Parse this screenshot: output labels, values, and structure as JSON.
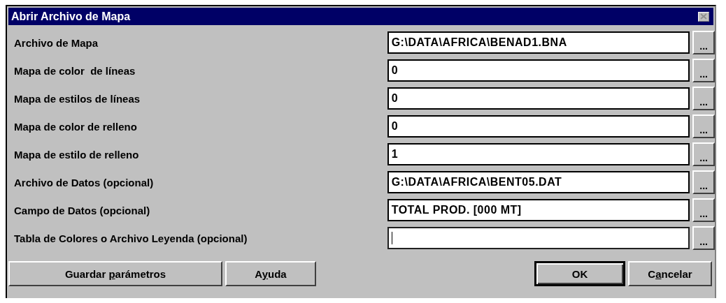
{
  "window": {
    "title": "Abrir Archivo de Mapa"
  },
  "fields": [
    {
      "label": "Archivo de Mapa",
      "value": "G:\\DATA\\AFRICA\\BENAD1.BNA",
      "browse": "...",
      "focused": false
    },
    {
      "label": "Mapa de color  de líneas",
      "value": "0",
      "browse": "...",
      "focused": false
    },
    {
      "label": "Mapa de estilos de líneas",
      "value": "0",
      "browse": "...",
      "focused": false
    },
    {
      "label": "Mapa de color de relleno",
      "value": "0",
      "browse": "...",
      "focused": false
    },
    {
      "label": "Mapa de estilo de relleno",
      "value": "1",
      "browse": "...",
      "focused": false
    },
    {
      "label": "Archivo de Datos (opcional)",
      "value": "G:\\DATA\\AFRICA\\BENT05.DAT",
      "browse": "...",
      "focused": false
    },
    {
      "label": "Campo de Datos (opcional)",
      "value": "TOTAL PROD. [000 MT]",
      "browse": "...",
      "focused": false
    },
    {
      "label": "Tabla de Colores o Archivo Leyenda (opcional)",
      "browse": "...",
      "focused": true
    }
  ],
  "left_buttons": [
    {
      "pre": "Guardar ",
      "key": "p",
      "post": "arámetros",
      "default": false
    },
    {
      "pre": "A",
      "key": "y",
      "post": "uda",
      "default": false
    }
  ],
  "right_buttons": [
    {
      "post": "OK",
      "default": true
    },
    {
      "pre": "C",
      "key": "a",
      "post": "ncelar",
      "default": false
    }
  ]
}
